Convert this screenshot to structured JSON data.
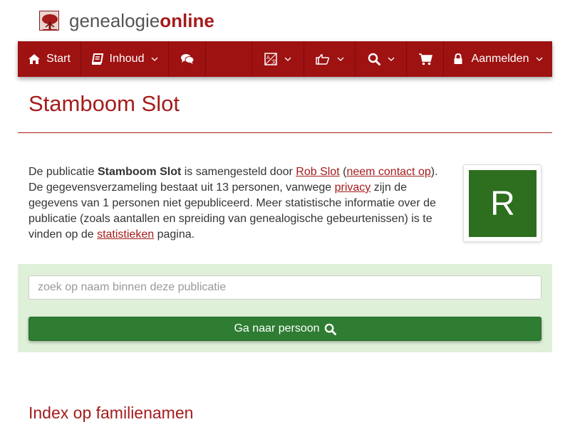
{
  "header": {
    "logo_icon": "tree-icon",
    "brand_part1": "genealogie",
    "brand_part2": "online"
  },
  "navbar": {
    "start_label": "Start",
    "inhoud_label": "Inhoud",
    "login_label": "Aanmelden",
    "icons": [
      "home-icon",
      "book-icon",
      "comments-icon",
      "language-icon",
      "thumbs-up-icon",
      "search-icon",
      "shopping-cart-icon",
      "lock-icon"
    ]
  },
  "page": {
    "title": "Stamboom Slot"
  },
  "intro": {
    "t1": "De publicatie ",
    "publication": "Stamboom Slot",
    "t2": " is samengesteld door ",
    "author_link": "Rob Slot",
    "t3": " (",
    "contact_link": "neem contact op",
    "t4": "). De gegevensverzameling bestaat uit 13 personen, vanwege ",
    "privacy_link": "privacy",
    "t5": " zijn de gegevens van 1 personen niet gepubliceerd. Meer statistische informatie over de publicatie (zoals aantallen en spreiding van genealogische gebeurtenissen) is te vinden op de ",
    "stats_link": "statistieken",
    "t6": " pagina."
  },
  "avatar": {
    "letter": "R",
    "color": "#2e6e1f"
  },
  "search": {
    "placeholder": "zoek op naam binnen deze publicatie",
    "button_label": "Ga naar persoon"
  },
  "sections": {
    "index_heading": "Index op familienamen"
  },
  "colors": {
    "brand_red": "#9e1212",
    "panel_green": "#dff0d8",
    "button_green": "#2e7d32"
  }
}
